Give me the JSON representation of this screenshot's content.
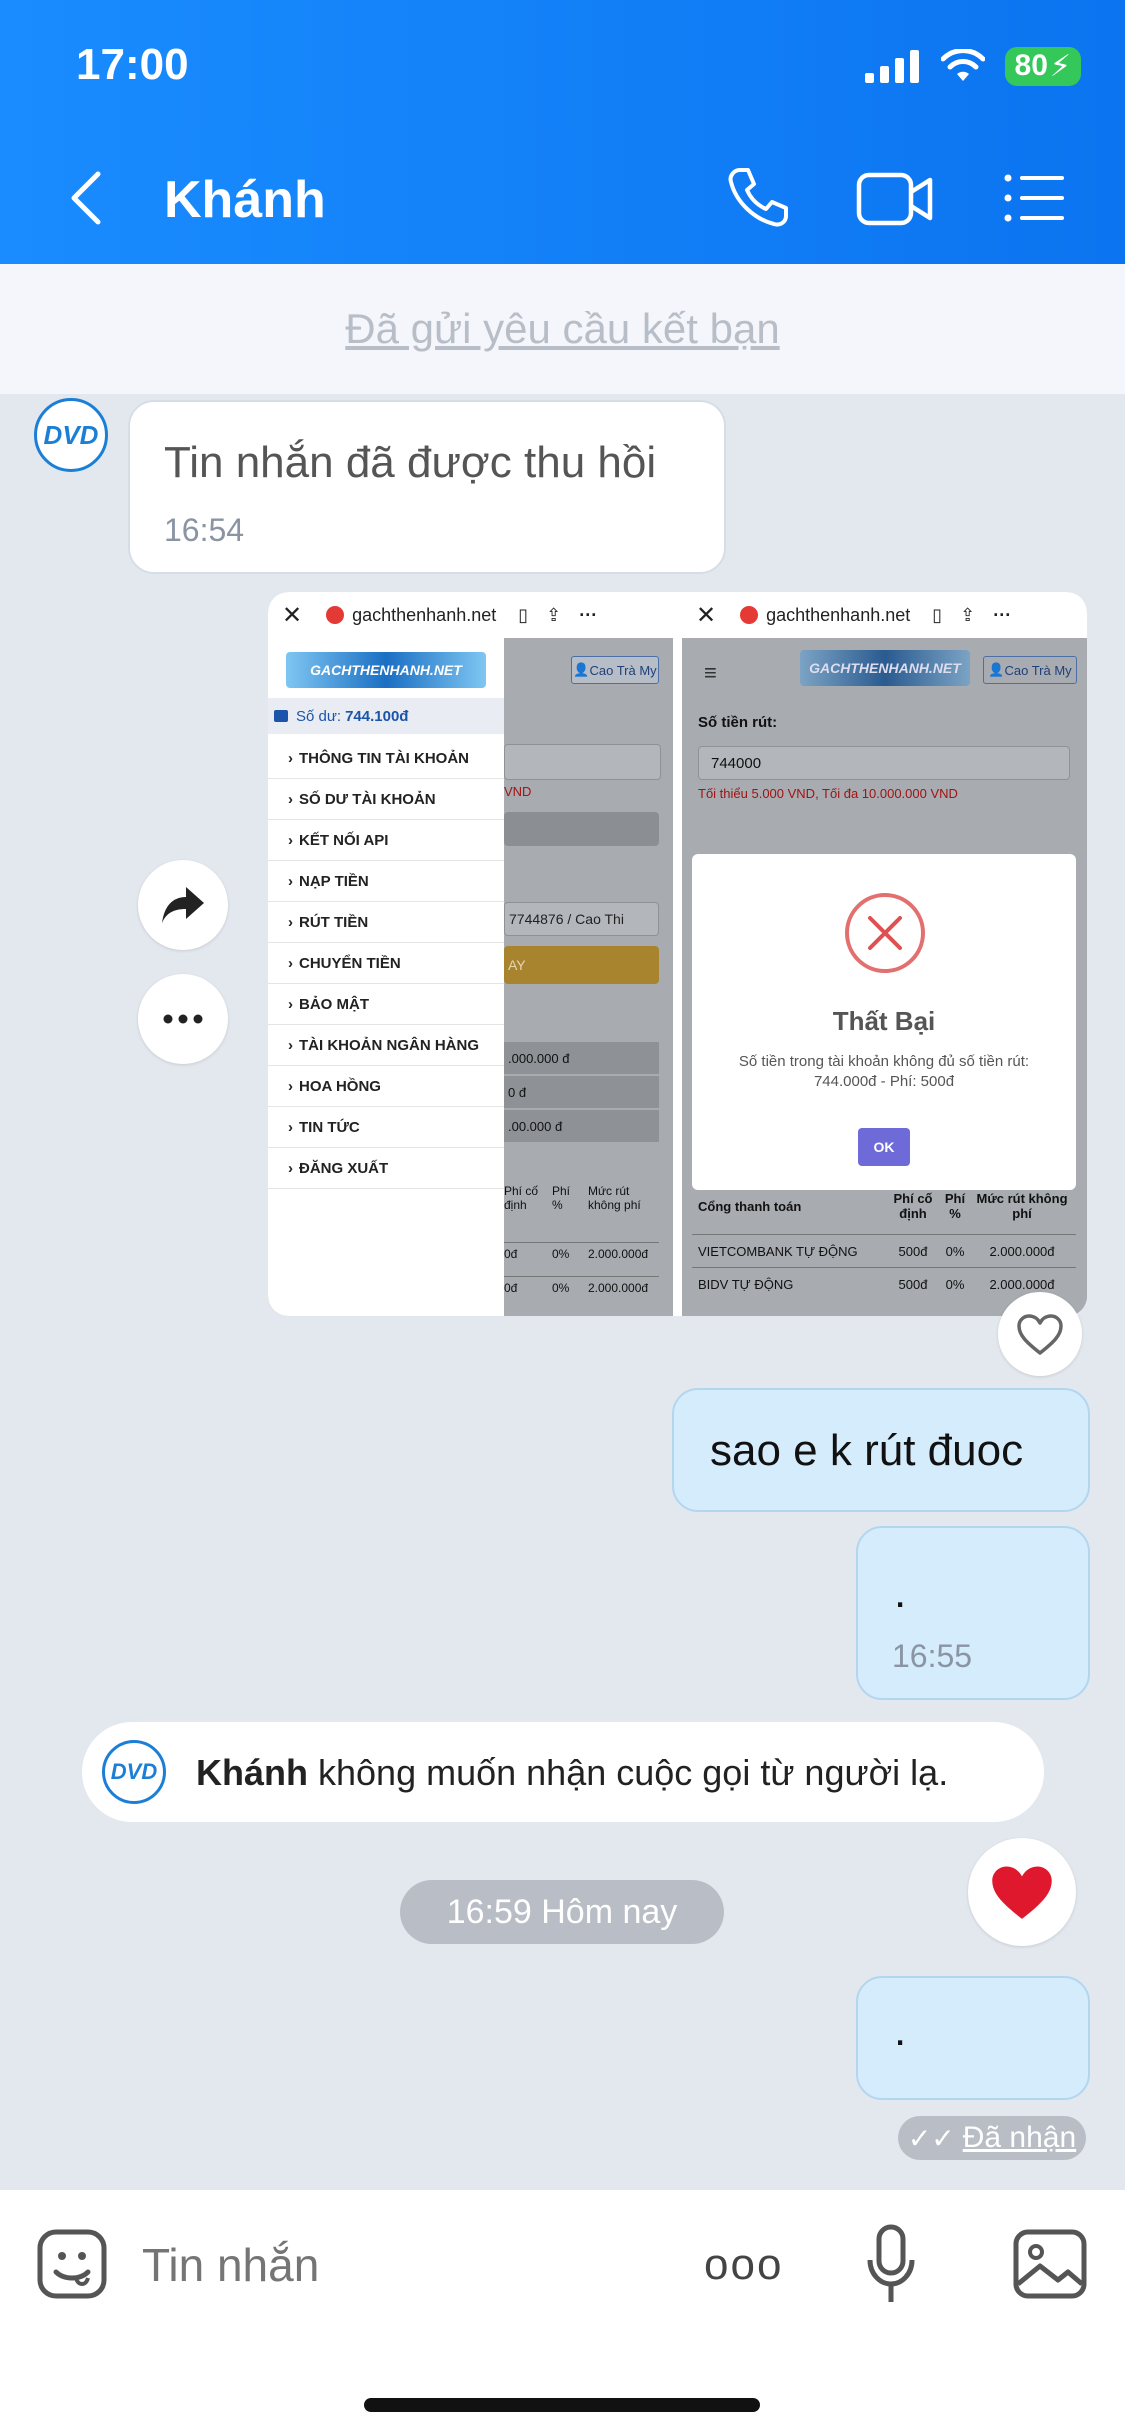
{
  "status_bar": {
    "time": "17:00",
    "battery": "80"
  },
  "header": {
    "title": "Khánh"
  },
  "friend_request": "Đã gửi yêu cầu kết bạn",
  "avatar_text": "DVD",
  "messages": {
    "recalled": {
      "text": "Tin nhắn đã được thu hồi",
      "time": "16:54"
    },
    "out1": {
      "text": "sao e k rút đuoc"
    },
    "out2": {
      "text": ".",
      "time": "16:55"
    },
    "system": {
      "name": "Khánh",
      "text": " không muốn nhận cuộc gọi từ người lạ."
    },
    "divider": "16:59 Hôm nay",
    "out3": {
      "text": "."
    },
    "receipt": "Đã nhận"
  },
  "reaction_emoji": "❤️",
  "screenshot": {
    "url": "gachthenhanh.net",
    "logo": "GACHTHENHANH.NET",
    "user_btn": "Cao Trà My",
    "balance_label": "Số dư:",
    "balance_value": "744.100đ",
    "menu": [
      "THÔNG TIN TÀI KHOẢN",
      "SỐ DƯ TÀI KHOẢN",
      "KẾT NỐI API",
      "NẠP TIỀN",
      "RÚT TIỀN",
      "CHUYỂN TIỀN",
      "BẢO MẬT",
      "TÀI KHOẢN NGÂN HÀNG",
      "HOA HỒNG",
      "TIN TỨC",
      "ĐĂNG XUẤT"
    ],
    "left_bg": {
      "vnd_hint": "VND",
      "account": "7744876 / Cao Thi",
      "btn": "AY",
      "amt1": ".000.000 đ",
      "amt2": "0 đ",
      "amt3": ".00.000 đ",
      "th_fixed": "Phí cố định",
      "th_pct": "Phí %",
      "th_free": "Mức rút không phí",
      "rows": [
        [
          "0đ",
          "0%",
          "2.000.000đ"
        ],
        [
          "0đ",
          "0%",
          "2.000.000đ"
        ]
      ]
    },
    "right": {
      "label": "Số tiền rút:",
      "amount": "744000",
      "hint": "Tối thiểu 5.000 VND, Tối đa 10.000.000 VND",
      "dialog_title": "Thất Bại",
      "dialog_msg": "Số tiền trong tài khoản không đủ số tiền rút: 744.000đ - Phí: 500đ",
      "ok": "OK",
      "th_gateway": "Cổng thanh toán",
      "th_fixed": "Phí cố định",
      "th_pct": "Phí %",
      "th_free": "Mức rút không phí",
      "rows": [
        [
          "VIETCOMBANK TỰ ĐỘNG",
          "500đ",
          "0%",
          "2.000.000đ"
        ],
        [
          "BIDV TỰ ĐỘNG",
          "500đ",
          "0%",
          "2.000.000đ"
        ]
      ]
    }
  },
  "composer": {
    "placeholder": "Tin nhắn",
    "more": "ooo"
  },
  "colors": {
    "header": "#0b74f0",
    "out_bubble": "#d4ecfc",
    "reaction": "#e0182d"
  }
}
